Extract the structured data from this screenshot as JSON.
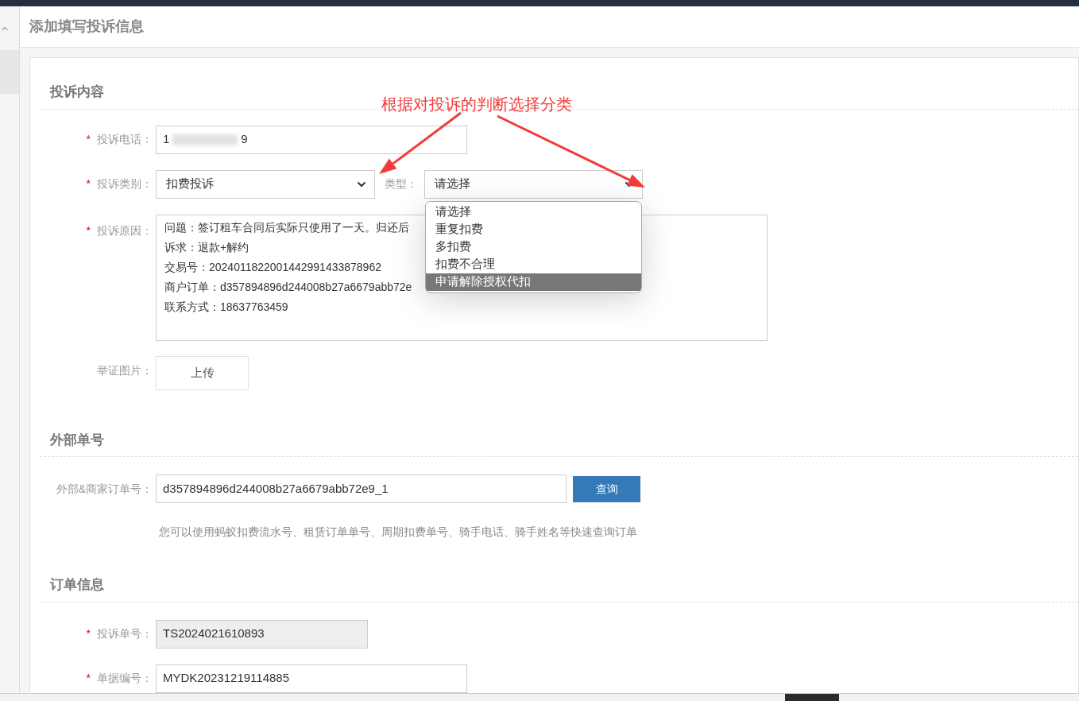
{
  "page_title": "添加填写投诉信息",
  "annotation": {
    "text": "根据对投诉的判断选择分类"
  },
  "complaint_content": {
    "heading": "投诉内容",
    "phone": {
      "label": "投诉电话：",
      "required_mark": "*",
      "value_start": "1",
      "value_end": "9"
    },
    "category": {
      "label": "投诉类别：",
      "required_mark": "*",
      "value": "扣费投诉"
    },
    "type": {
      "label": "类型：",
      "value": "请选择",
      "expanded": true,
      "options": [
        {
          "label": "请选择",
          "highlighted": false
        },
        {
          "label": "重复扣费",
          "highlighted": false
        },
        {
          "label": "多扣费",
          "highlighted": false
        },
        {
          "label": "扣费不合理",
          "highlighted": false
        },
        {
          "label": "申请解除授权代扣",
          "highlighted": true
        }
      ]
    },
    "reason": {
      "label": "投诉原因：",
      "required_mark": "*",
      "lines": [
        "问题：签订租车合同后实际只使用了一天。归还后",
        "诉求：退款+解约",
        "交易号：2024011822001442991433878962",
        "商户订单：d357894896d244008b27a6679abb72e",
        "联系方式：18637763459"
      ]
    },
    "evidence": {
      "label": "举证图片：",
      "button": "上传"
    }
  },
  "external": {
    "heading": "外部单号",
    "label": "外部&商家订单号：",
    "value": "d357894896d244008b27a6679abb72e9_1",
    "button": "查询",
    "hint": "您可以使用蚂蚁扣费流水号、租赁订单单号、周期扣费单号、骑手电话、骑手姓名等快速查询订单"
  },
  "order_info": {
    "heading": "订单信息",
    "complaint_no": {
      "label": "投诉单号：",
      "required_mark": "*",
      "value": "TS2024021610893",
      "disabled": true
    },
    "document_no": {
      "label": "单据编号：",
      "required_mark": "*",
      "value": "MYDK20231219114885",
      "disabled": false
    }
  }
}
